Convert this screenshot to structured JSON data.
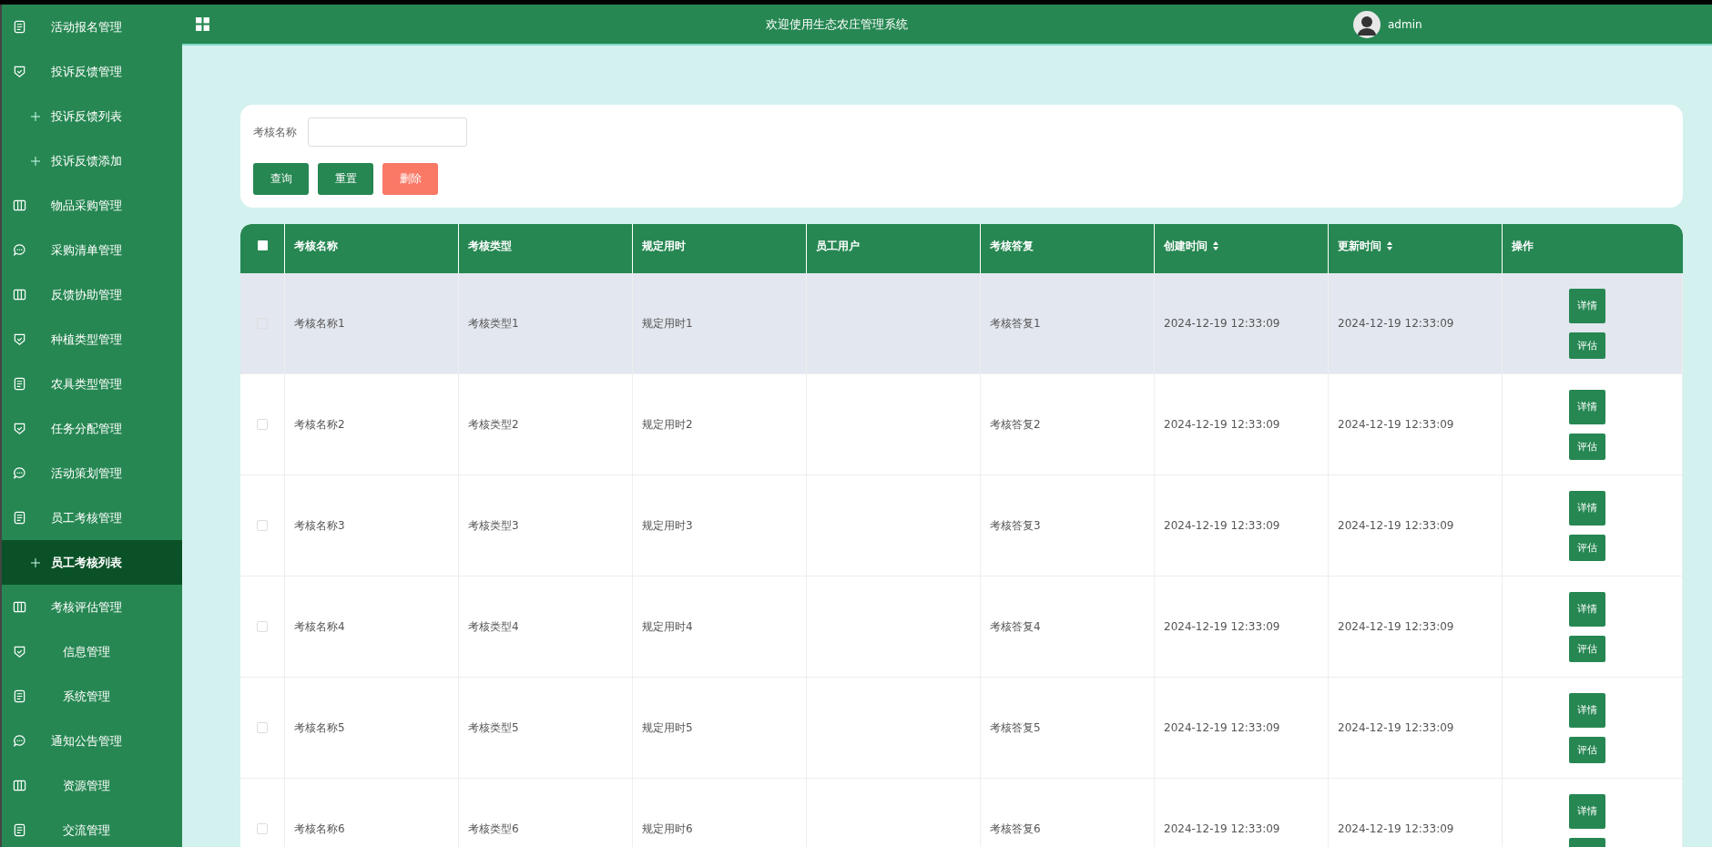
{
  "sidebar": {
    "items": [
      {
        "label": "活动报名管理",
        "kind": "document",
        "selected": false
      },
      {
        "label": "投诉反馈管理",
        "kind": "shield",
        "selected": false
      },
      {
        "label": "投诉反馈列表",
        "kind": "sub",
        "selected": false
      },
      {
        "label": "投诉反馈添加",
        "kind": "sub",
        "selected": false
      },
      {
        "label": "物品采购管理",
        "kind": "columns",
        "selected": false
      },
      {
        "label": "采购清单管理",
        "kind": "chat",
        "selected": false
      },
      {
        "label": "反馈协助管理",
        "kind": "columns",
        "selected": false
      },
      {
        "label": "种植类型管理",
        "kind": "shield",
        "selected": false
      },
      {
        "label": "农具类型管理",
        "kind": "document",
        "selected": false
      },
      {
        "label": "任务分配管理",
        "kind": "shield",
        "selected": false
      },
      {
        "label": "活动策划管理",
        "kind": "chat",
        "selected": false
      },
      {
        "label": "员工考核管理",
        "kind": "document",
        "selected": false
      },
      {
        "label": "员工考核列表",
        "kind": "sub",
        "selected": true
      },
      {
        "label": "考核评估管理",
        "kind": "columns",
        "selected": false
      },
      {
        "label": "信息管理",
        "kind": "shield",
        "selected": false
      },
      {
        "label": "系统管理",
        "kind": "document",
        "selected": false
      },
      {
        "label": "通知公告管理",
        "kind": "chat",
        "selected": false
      },
      {
        "label": "资源管理",
        "kind": "columns",
        "selected": false
      },
      {
        "label": "交流管理",
        "kind": "document",
        "selected": false
      }
    ]
  },
  "header": {
    "title": "欢迎使用生态农庄管理系统",
    "user": "admin"
  },
  "search": {
    "label": "考核名称",
    "buttons": [
      {
        "label": "查询",
        "kind": "primary"
      },
      {
        "label": "重置",
        "kind": "primary"
      },
      {
        "label": "删除",
        "kind": "danger"
      }
    ]
  },
  "table": {
    "all_checked": false,
    "columns": [
      {
        "label": "考核名称",
        "sortable": false
      },
      {
        "label": "考核类型",
        "sortable": false
      },
      {
        "label": "规定用时",
        "sortable": false
      },
      {
        "label": "员工用户",
        "sortable": false
      },
      {
        "label": "考核答复",
        "sortable": false
      },
      {
        "label": "创建时间",
        "sortable": true
      },
      {
        "label": "更新时间",
        "sortable": true
      },
      {
        "label": "操作",
        "sortable": false
      }
    ],
    "rows": [
      {
        "cells": [
          "考核名称1",
          "考核类型1",
          "规定用时1",
          "",
          "考核答复1",
          "2024-12-19 12:33:09",
          "2024-12-19 12:33:09"
        ],
        "hovered": true,
        "actions": [
          "详情",
          "评估"
        ]
      },
      {
        "cells": [
          "考核名称2",
          "考核类型2",
          "规定用时2",
          "",
          "考核答复2",
          "2024-12-19 12:33:09",
          "2024-12-19 12:33:09"
        ],
        "hovered": false,
        "actions": [
          "详情",
          "评估"
        ]
      },
      {
        "cells": [
          "考核名称3",
          "考核类型3",
          "规定用时3",
          "",
          "考核答复3",
          "2024-12-19 12:33:09",
          "2024-12-19 12:33:09"
        ],
        "hovered": false,
        "actions": [
          "详情",
          "评估"
        ]
      },
      {
        "cells": [
          "考核名称4",
          "考核类型4",
          "规定用时4",
          "",
          "考核答复4",
          "2024-12-19 12:33:09",
          "2024-12-19 12:33:09"
        ],
        "hovered": false,
        "actions": [
          "详情",
          "评估"
        ]
      },
      {
        "cells": [
          "考核名称5",
          "考核类型5",
          "规定用时5",
          "",
          "考核答复5",
          "2024-12-19 12:33:09",
          "2024-12-19 12:33:09"
        ],
        "hovered": false,
        "actions": [
          "详情",
          "评估"
        ]
      },
      {
        "cells": [
          "考核名称6",
          "考核类型6",
          "规定用时6",
          "",
          "考核答复6",
          "2024-12-19 12:33:09",
          "2024-12-19 12:33:09"
        ],
        "hovered": false,
        "actions": [
          "详情"
        ]
      }
    ]
  }
}
